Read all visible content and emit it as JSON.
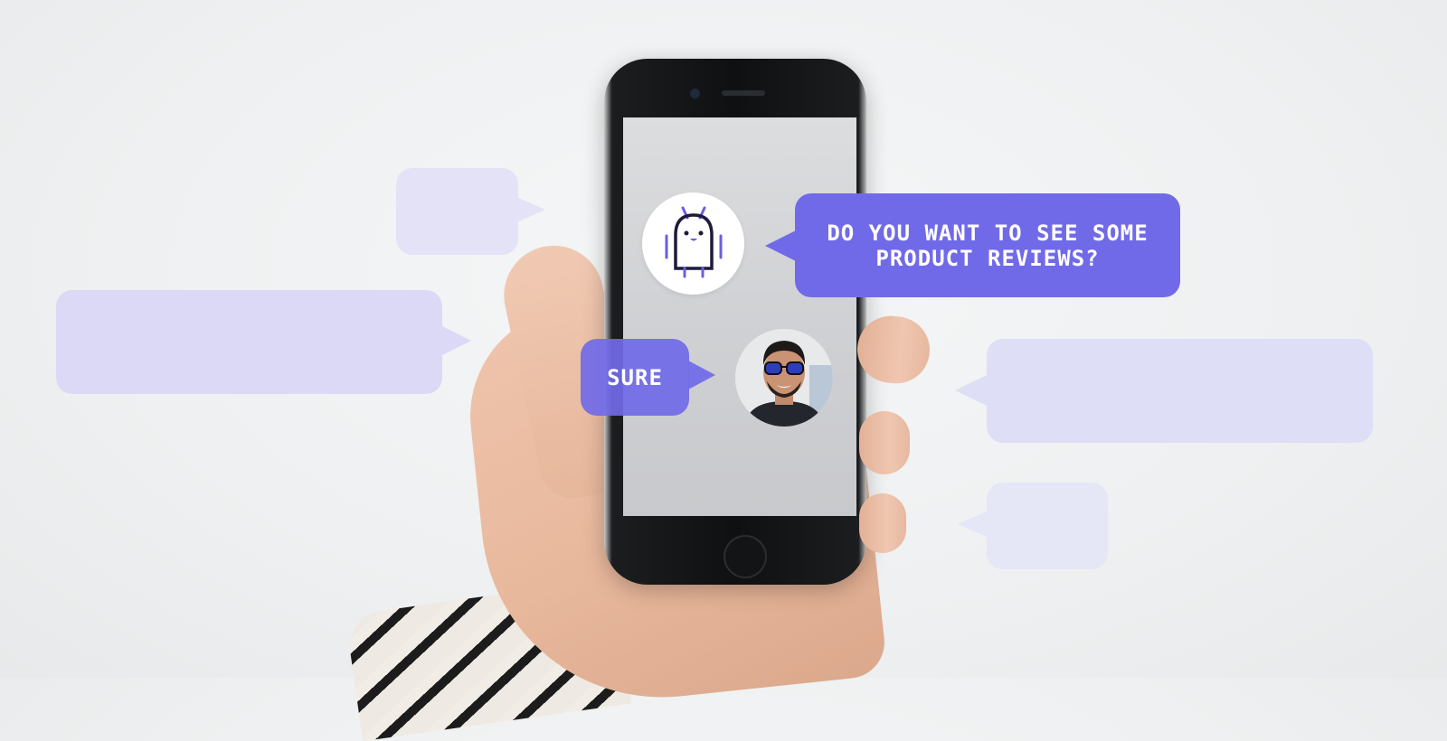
{
  "conversation": {
    "bot_message_line1": "DO YOU WANT TO SEE SOME",
    "bot_message_line2": "PRODUCT REVIEWS?",
    "user_reply": "SURE"
  },
  "icons": {
    "bot": "robot-icon",
    "user": "user-avatar-photo"
  },
  "colors": {
    "bubble_primary": "#716ae8",
    "bubble_ghost": "#dcdbf6",
    "bubble_ghost_light": "#e6e6f6",
    "background": "#eef0f1"
  }
}
